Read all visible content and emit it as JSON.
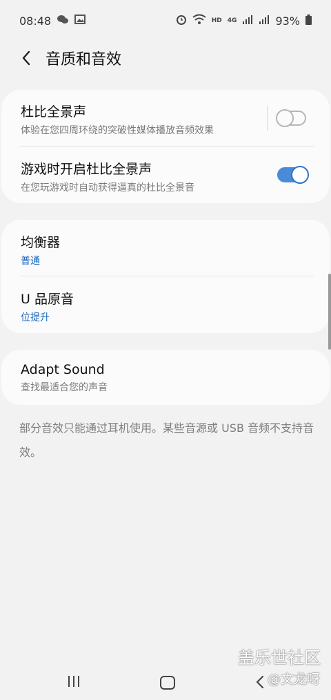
{
  "status_bar": {
    "time": "08:48",
    "battery": "93%",
    "network_hd": "HD",
    "network_4g": "4G"
  },
  "header": {
    "title": "音质和音效"
  },
  "card1": {
    "items": [
      {
        "title": "杜比全景声",
        "subtitle": "体验在您四周环绕的突破性媒体播放音频效果",
        "toggle": false
      },
      {
        "title": "游戏时开启杜比全景声",
        "subtitle": "在您玩游戏时自动获得逼真的杜比全景音",
        "toggle": true
      }
    ]
  },
  "card2": {
    "items": [
      {
        "title": "均衡器",
        "subtitle": "普通"
      },
      {
        "title": "U 品原音",
        "subtitle": "位提升"
      }
    ]
  },
  "card3": {
    "items": [
      {
        "title": "Adapt Sound",
        "subtitle": "查找最适合您的声音"
      }
    ]
  },
  "footer_note": "部分音效只能通过耳机使用。某些音源或 USB 音频不支持音效。",
  "watermark": {
    "main": "盖乐世社区",
    "sub": "@文龙呀"
  },
  "colors": {
    "accent": "#4a8bd8",
    "link_blue": "#1565c0",
    "background": "#f2f2f2",
    "card": "#fbfbfb"
  }
}
